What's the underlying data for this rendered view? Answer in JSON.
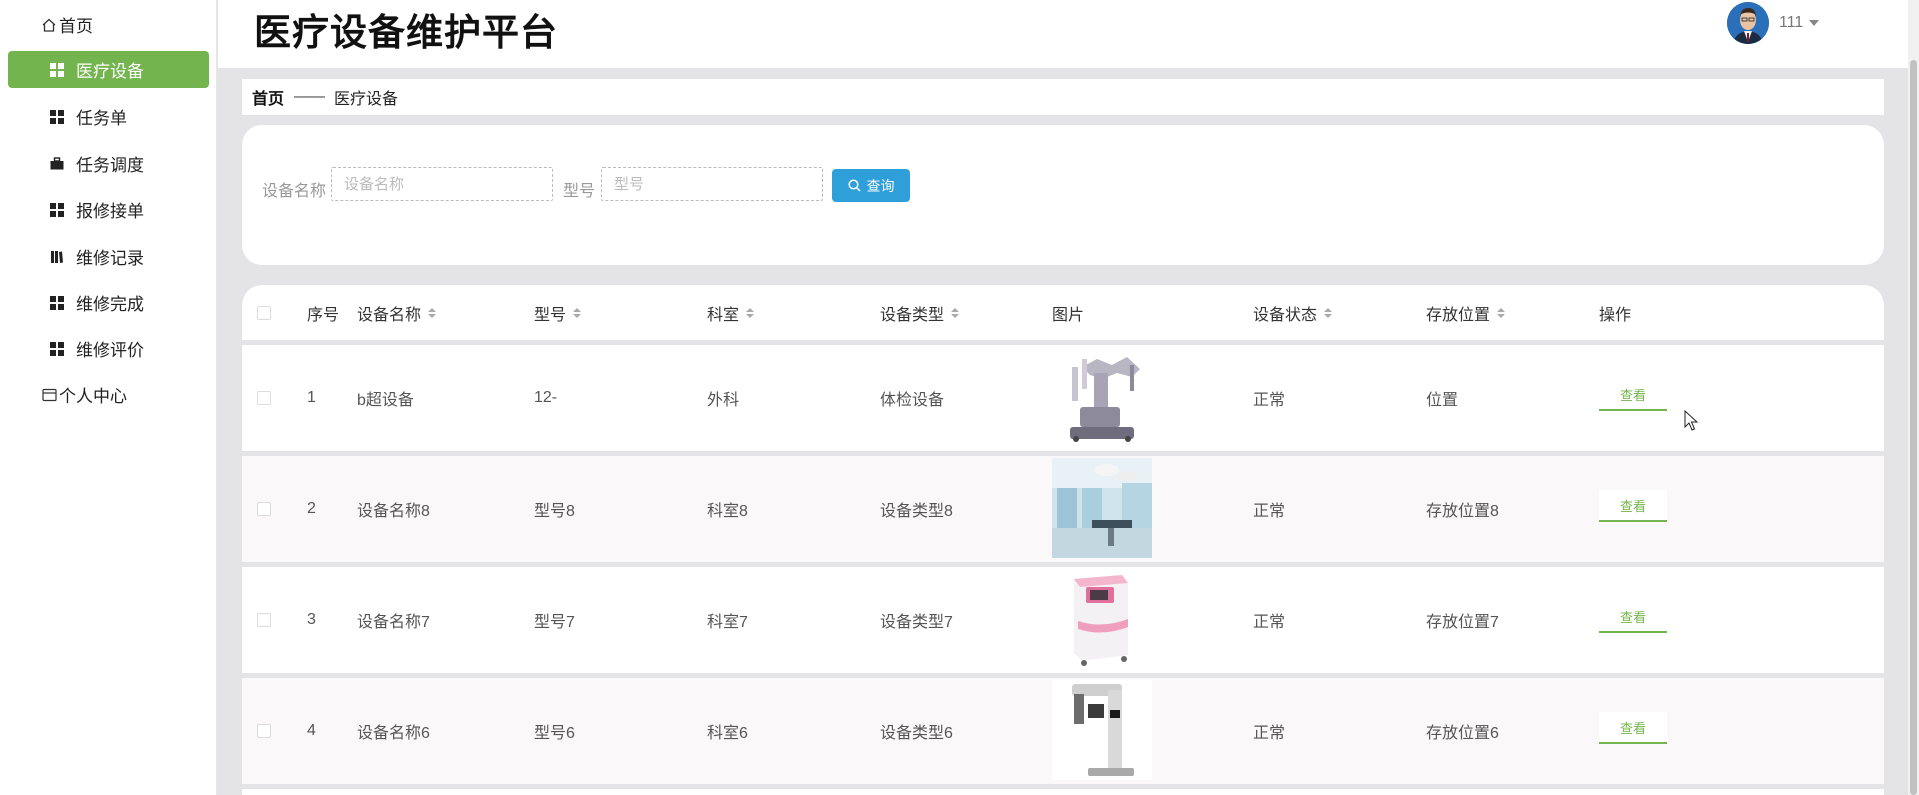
{
  "app": {
    "title": "医疗设备维护平台",
    "accent_color": "#74b44e",
    "query_color": "#2e9fd8"
  },
  "sidebar": {
    "items": [
      {
        "label": "首页",
        "icon": "home-icon"
      },
      {
        "label": "医疗设备",
        "icon": "grid-icon",
        "active": true
      },
      {
        "label": "任务单",
        "icon": "grid-icon"
      },
      {
        "label": "任务调度",
        "icon": "briefcase-icon"
      },
      {
        "label": "报修接单",
        "icon": "grid-icon"
      },
      {
        "label": "维修记录",
        "icon": "book-icon"
      },
      {
        "label": "维修完成",
        "icon": "grid-icon"
      },
      {
        "label": "维修评价",
        "icon": "grid-icon"
      },
      {
        "label": "个人中心",
        "icon": "wallet-icon"
      }
    ]
  },
  "user": {
    "name": "111",
    "icon": "chevron-down-icon"
  },
  "breadcrumb": {
    "home": "首页",
    "separator": "——",
    "current": "医疗设备"
  },
  "search": {
    "name_label": "设备名称",
    "name_placeholder": "设备名称",
    "model_label": "型号",
    "model_placeholder": "型号",
    "button_label": "查询"
  },
  "table": {
    "headers": [
      "序号",
      "设备名称",
      "型号",
      "科室",
      "设备类型",
      "图片",
      "设备状态",
      "存放位置",
      "操作"
    ],
    "rows": [
      {
        "index": "1",
        "name": "b超设备",
        "model": "12-",
        "dept": "外科",
        "type": "体检设备",
        "image": "surgical-robot-image",
        "status": "正常",
        "location": "位置",
        "action": "查看"
      },
      {
        "index": "2",
        "name": "设备名称8",
        "model": "型号8",
        "dept": "科室8",
        "type": "设备类型8",
        "image": "operating-room-image",
        "status": "正常",
        "location": "存放位置8",
        "action": "查看"
      },
      {
        "index": "3",
        "name": "设备名称7",
        "model": "型号7",
        "dept": "科室7",
        "type": "设备类型7",
        "image": "pink-device-image",
        "status": "正常",
        "location": "存放位置7",
        "action": "查看"
      },
      {
        "index": "4",
        "name": "设备名称6",
        "model": "型号6",
        "dept": "科室6",
        "type": "设备类型6",
        "image": "dental-xray-image",
        "status": "正常",
        "location": "存放位置6",
        "action": "查看"
      }
    ]
  }
}
